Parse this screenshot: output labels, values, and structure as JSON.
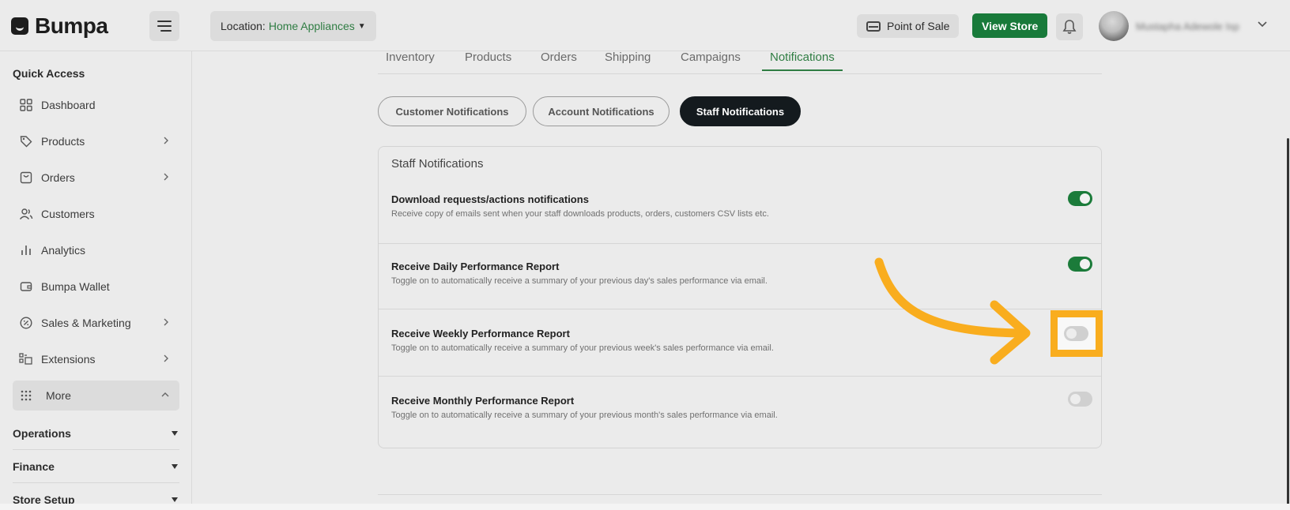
{
  "app": {
    "logo_text": "Bumpa"
  },
  "header": {
    "location_label": "Location:",
    "location_value": "Home Appliances",
    "pos_label": "Point of Sale",
    "view_store_label": "View Store",
    "username": "Mustapha Adewole Isp"
  },
  "sidebar": {
    "quick_access_title": "Quick Access",
    "items": [
      {
        "label": "Dashboard",
        "icon": "dashboard-icon",
        "has_chevron": false
      },
      {
        "label": "Products",
        "icon": "tag-icon",
        "has_chevron": true
      },
      {
        "label": "Orders",
        "icon": "bag-icon",
        "has_chevron": true
      },
      {
        "label": "Customers",
        "icon": "users-icon",
        "has_chevron": false
      },
      {
        "label": "Analytics",
        "icon": "analytics-icon",
        "has_chevron": false
      },
      {
        "label": "Bumpa Wallet",
        "icon": "wallet-icon",
        "has_chevron": false
      },
      {
        "label": "Sales & Marketing",
        "icon": "percent-icon",
        "has_chevron": true
      },
      {
        "label": "Extensions",
        "icon": "extensions-icon",
        "has_chevron": true
      }
    ],
    "more_label": "More",
    "groups": [
      {
        "label": "Operations"
      },
      {
        "label": "Finance"
      },
      {
        "label": "Store Setup"
      }
    ]
  },
  "tabs": [
    {
      "label": "Inventory",
      "active": false
    },
    {
      "label": "Products",
      "active": false
    },
    {
      "label": "Orders",
      "active": false
    },
    {
      "label": "Shipping",
      "active": false
    },
    {
      "label": "Campaigns",
      "active": false
    },
    {
      "label": "Notifications",
      "active": true
    }
  ],
  "subtabs": [
    {
      "label": "Customer Notifications",
      "active": false
    },
    {
      "label": "Account Notifications",
      "active": false
    },
    {
      "label": "Staff Notifications",
      "active": true
    }
  ],
  "card": {
    "title": "Staff Notifications",
    "rows": [
      {
        "title": "Download requests/actions notifications",
        "desc": "Receive copy of emails sent when your staff downloads products, orders, customers CSV lists etc.",
        "enabled": true
      },
      {
        "title": "Receive Daily Performance Report",
        "desc": "Toggle on to automatically receive a summary of your previous day's sales performance via email.",
        "enabled": true
      },
      {
        "title": "Receive Weekly Performance Report",
        "desc": "Toggle on to automatically receive a summary of your previous week's sales performance via email.",
        "enabled": false
      },
      {
        "title": "Receive Monthly Performance Report",
        "desc": "Toggle on to automatically receive a summary of your previous month's sales performance via email.",
        "enabled": false
      }
    ]
  },
  "colors": {
    "brand_green": "#187a3a",
    "annotation_orange": "#f9ad1e",
    "active_pill": "#141a1e"
  }
}
